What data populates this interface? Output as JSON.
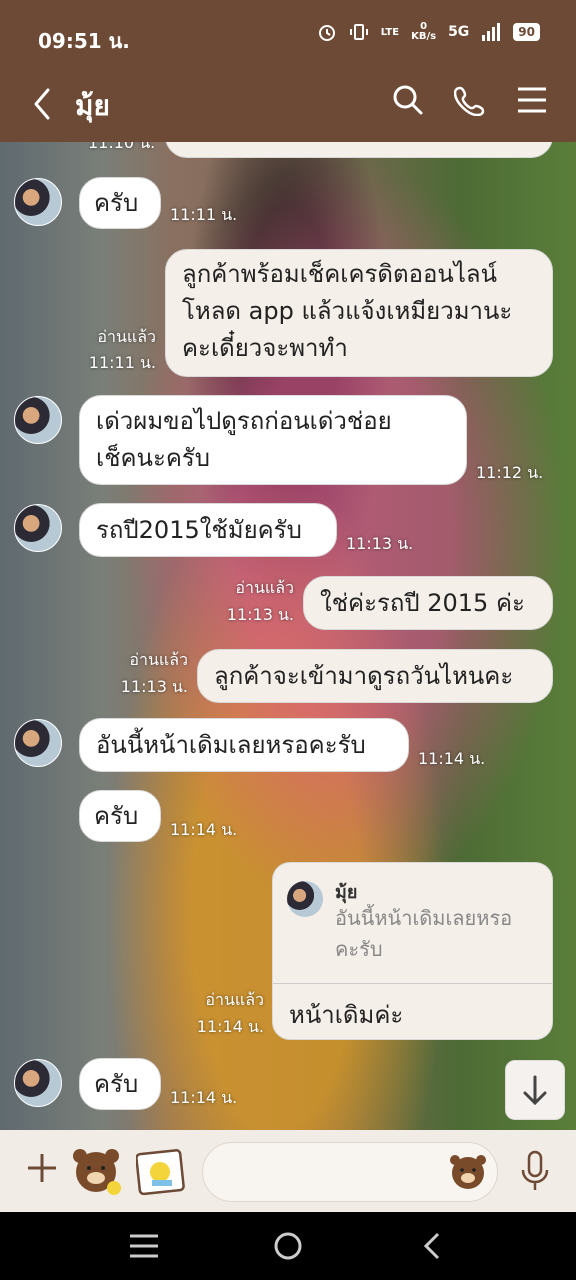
{
  "status": {
    "time": "09:51 น.",
    "net": "5G",
    "speed_top": "0",
    "speed_unit": "KB/s",
    "lte": "LTE",
    "battery": "90"
  },
  "header": {
    "title": "มุ้ย"
  },
  "messages": [
    {
      "time": "11:10 น."
    },
    {
      "text": "ครับ",
      "time": "11:11 น."
    },
    {
      "text": "ลูกค้าพร้อมเช็คเครดิตออนไลน์โหลด app แล้วแจ้งเหมียวมานะคะเดี๋ยวจะพาทำ",
      "line1": "ลูกค้าพร้อมเช็คเครดิตออนไลน์",
      "line2": "โหลด app แล้วแจ้งเหมียวมานะ",
      "line3": "คะเดี๋ยวจะพาทำ",
      "read": "อ่านแล้ว",
      "time": "11:11 น."
    },
    {
      "line1": "เด่วผมขอไปดูรถก่อนเด่วช่อย",
      "line2": "เช็คนะครับ",
      "time": "11:12 น."
    },
    {
      "text": "รถปี2015ใช้มัยครับ",
      "time": "11:13 น."
    },
    {
      "text": "ใช่ค่ะรถปี 2015 ค่ะ",
      "read": "อ่านแล้ว",
      "time": "11:13 น."
    },
    {
      "text": "ลูกค้าจะเข้ามาดูรถวันไหนคะ",
      "read": "อ่านแล้ว",
      "time": "11:13 น."
    },
    {
      "text": "อันนี้หน้าเดิมเลยหรอคะรับ",
      "time": "11:14 น."
    },
    {
      "text": "ครับ",
      "time": "11:14 น."
    },
    {
      "reply_name": "มุ้ย",
      "reply_quote": "อันนี้หน้าเดิมเลยหรอคะรับ",
      "quote1": "อันนี้หน้าเดิมเลยหรอ",
      "quote2": "คะรับ",
      "text": "หน้าเดิมค่ะ",
      "read": "อ่านแล้ว",
      "time": "11:14 น."
    },
    {
      "text": "ครับ",
      "time": "11:14 น."
    }
  ],
  "icons": [
    "back-icon",
    "search-icon",
    "phone-icon",
    "menu-icon",
    "plus-icon",
    "sticker-icon",
    "photo-icon",
    "emoji-icon",
    "mic-icon",
    "down-arrow-icon",
    "nav-menu-icon",
    "nav-home-icon",
    "nav-back-icon"
  ]
}
